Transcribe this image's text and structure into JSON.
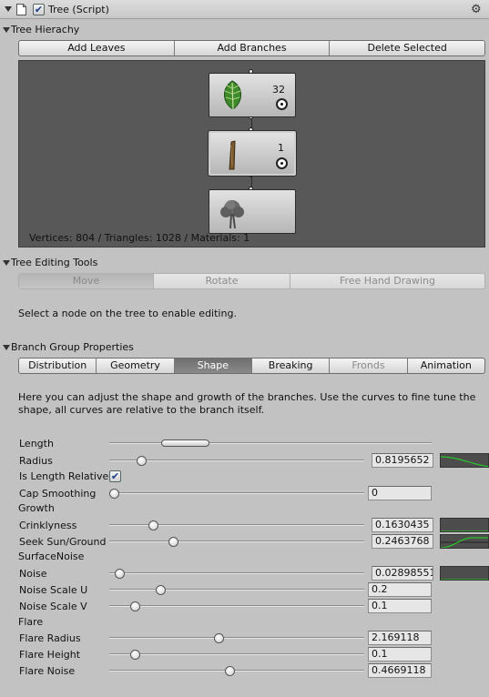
{
  "colors": {
    "panel": "#c2c2c2",
    "graph_bg": "#585858",
    "selected_tab": "#7a7a7a",
    "curve_green": "#22dd22"
  },
  "header": {
    "title": "Tree (Script)",
    "checked": true,
    "icons": [
      "foldout-icon",
      "script-file-icon",
      "checkbox-icon",
      "gear-icon"
    ]
  },
  "hierarchy": {
    "title": "Tree Hierachy",
    "buttons": [
      "Add Leaves",
      "Add Branches",
      "Delete Selected"
    ],
    "nodes": [
      {
        "kind": "leaf",
        "icon": "leaf-icon",
        "count": "32",
        "visible": true
      },
      {
        "kind": "branch",
        "icon": "branch-icon",
        "count": "1",
        "visible": true,
        "selected": true
      },
      {
        "kind": "root",
        "icon": "tree-icon"
      }
    ],
    "stats": "Vertices: 804 / Triangles: 1028 / Materials: 1"
  },
  "tools": {
    "title": "Tree Editing Tools",
    "tabs": [
      "Move",
      "Rotate",
      "Free Hand Drawing"
    ],
    "hint": "Select a node on the tree to enable editing."
  },
  "branch": {
    "title": "Branch Group Properties",
    "tabs": [
      "Distribution",
      "Geometry",
      "Shape",
      "Breaking",
      "Fronds",
      "Animation"
    ],
    "selected_tab": "Shape",
    "disabled_tab": "Fronds",
    "description": "Here you can adjust the shape and growth of the branches. Use the curves to fine tune the shape, all curves are relative to the branch itself."
  },
  "properties": {
    "length": {
      "label": "Length",
      "range_min": 0.16,
      "range_max": 0.31
    },
    "radius": {
      "label": "Radius",
      "value": "0.8195652",
      "level": 0.125
    },
    "is_length_relative": {
      "label": "Is Length Relative",
      "checked": true
    },
    "cap_smoothing": {
      "label": "Cap Smoothing",
      "value": "0",
      "level": 0.0
    },
    "growth_title": "Growth",
    "crinklyness": {
      "label": "Crinklyness",
      "value": "0.1630435",
      "level": 0.17
    },
    "seek_sun": {
      "label": "Seek Sun/Ground",
      "value": "0.2463768",
      "level": 0.25
    },
    "surface_noise_title": "SurfaceNoise",
    "noise": {
      "label": "Noise",
      "value": "0.02898551",
      "level": 0.04
    },
    "noise_scale_u": {
      "label": "Noise Scale U",
      "value": "0.2",
      "level": 0.2
    },
    "noise_scale_v": {
      "label": "Noise Scale V",
      "value": "0.1",
      "level": 0.1
    },
    "flare_title": "Flare",
    "flare_radius": {
      "label": "Flare Radius",
      "value": "2.169118",
      "level": 0.43
    },
    "flare_height": {
      "label": "Flare Height",
      "value": "0.1",
      "level": 0.1
    },
    "flare_noise": {
      "label": "Flare Noise",
      "value": "0.4669118",
      "level": 0.47
    }
  }
}
